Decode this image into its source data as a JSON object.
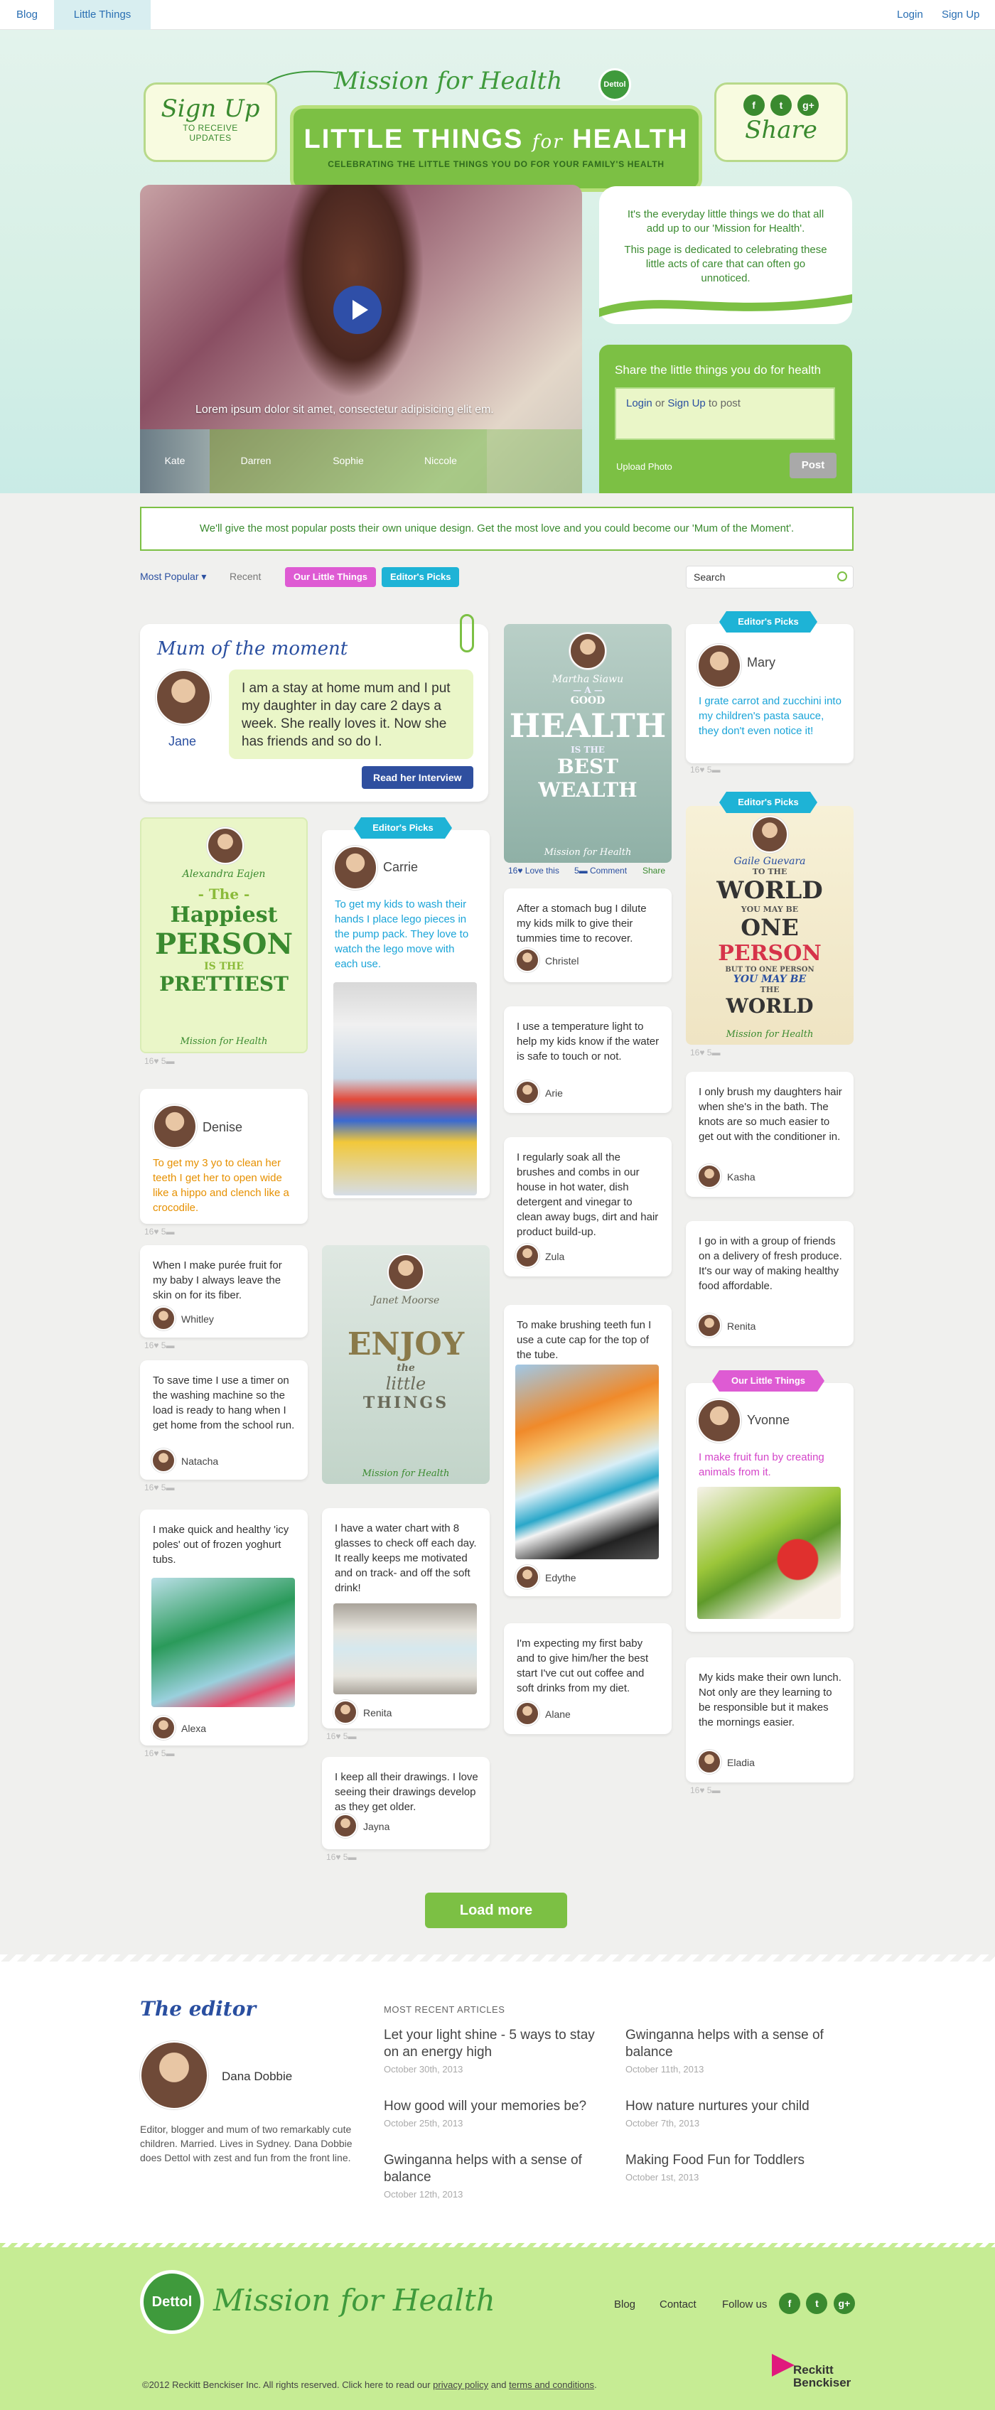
{
  "nav": {
    "blog": "Blog",
    "little_things": "Little Things",
    "login": "Login",
    "signup": "Sign Up"
  },
  "brand": {
    "mission": "Mission for Health",
    "dettol": "Dettol"
  },
  "signup_badge": {
    "title": "Sign Up",
    "line1": "TO RECEIVE",
    "line2": "UPDATES"
  },
  "banner": {
    "title_a": "LITTLE THINGS",
    "title_for": "for",
    "title_b": "HEALTH",
    "subtitle": "CELEBRATING THE LITTLE THINGS YOU DO FOR YOUR FAMILY'S HEALTH"
  },
  "share_badge": {
    "title": "Share",
    "icons": [
      "f",
      "t",
      "g+"
    ]
  },
  "video": {
    "caption": "Lorem ipsum dolor sit amet, consectetur adipisicing elit em.",
    "thumbs": [
      "Kate",
      "Darren",
      "Sophie",
      "Niccole"
    ]
  },
  "intro": {
    "p1": "It's the everyday little things we do that all add up to our 'Mission for Health'.",
    "p2": "This page is dedicated to celebrating these little acts of care that can often go unnoticed."
  },
  "share_form": {
    "label": "Share the little things you do for health",
    "login": "Login",
    "or": " or ",
    "signup": "Sign Up",
    "to_post": " to post",
    "upload": "Upload Photo",
    "post": "Post"
  },
  "notice": "We'll give the most popular posts their own unique design.  Get the most love and you could become our 'Mum of the Moment'.",
  "filters": {
    "most_popular": "Most Popular ▾",
    "recent": "Recent",
    "our_little_things": "Our Little Things",
    "editors_picks": "Editor's Picks",
    "search_placeholder": "Search"
  },
  "colors": {
    "green": "#7cc044",
    "dark_green": "#3a8a2f",
    "blue_ribbon": "#1eb3d6",
    "magenta_ribbon": "#de5bd3",
    "navy": "#2f4f9f"
  },
  "mum": {
    "title": "Mum of the moment",
    "quote": "I am a stay at home mum and I put my daughter in day care 2 days a week. She really loves it. Now she has friends and so do I.",
    "name": "Jane",
    "button": "Read her Interview"
  },
  "stats": {
    "default": "16♥ 5▬"
  },
  "col1": {
    "poster": {
      "name": "Alexandra Eajen",
      "l1": "- The -",
      "l2": "Happiest",
      "l3": "PERSON",
      "l4": "IS THE",
      "l5": "PRETTIEST",
      "foot": "Mission for Health"
    },
    "denise": {
      "name": "Denise",
      "text": "To get my 3 yo to clean her teeth I get her to open wide like a hippo and clench like a crocodile."
    },
    "whitley": {
      "text": "When I make purée fruit for my baby I always leave the skin on for its fiber.",
      "name": "Whitley"
    },
    "natacha": {
      "text": "To save time I use a timer on the washing machine so the load is ready to hang when I get home from the school run.",
      "name": "Natacha"
    },
    "alexa": {
      "text": "I make quick and healthy 'icy poles' out of frozen yoghurt tubs.",
      "name": "Alexa"
    }
  },
  "col2": {
    "carrie": {
      "ribbon": "Editor's Picks",
      "name": "Carrie",
      "text": "To get my kids to wash their hands I place lego pieces in the pump pack. They love to watch the lego move with each use."
    },
    "poster": {
      "name": "Janet Moorse",
      "l1": "ENJOY",
      "l2": "the",
      "l3": "little",
      "l4": "THINGS",
      "foot": "Mission for Health"
    },
    "renita": {
      "text": "I have a water chart with 8 glasses to check off each day. It really keeps me motivated and on track- and off the soft drink!",
      "name": "Renita"
    },
    "jayna": {
      "text": "I keep all their drawings. I love seeing their drawings develop as they get older.",
      "name": "Jayna"
    }
  },
  "col3": {
    "poster": {
      "name": "Martha Siawu",
      "l1": "— A —",
      "l2": "GOOD",
      "l3": "HEALTH",
      "l4": "IS THE",
      "l5": "BEST",
      "l6": "WEALTH",
      "foot": "Mission for Health",
      "love": "16♥ Love this",
      "comment": "5▬ Comment",
      "share": "Share"
    },
    "christel": {
      "text": "After a stomach bug I dilute my kids milk to give their tummies time to recover.",
      "name": "Christel"
    },
    "arie": {
      "text": "I use a temperature light to help my kids know if the water is safe to touch or not.",
      "name": "Arie"
    },
    "zula": {
      "text": "I regularly soak all the brushes and combs in our house in hot water, dish detergent and vinegar to clean away bugs, dirt and hair product build-up.",
      "name": "Zula"
    },
    "edythe": {
      "text": "To make brushing teeth fun I use a cute cap for the top of the tube.",
      "name": "Edythe"
    },
    "alane": {
      "text": "I'm expecting my first baby and to give him/her the best start I've cut out coffee and soft drinks from my diet.",
      "name": "Alane"
    }
  },
  "col4": {
    "mary": {
      "ribbon": "Editor's Picks",
      "name": "Mary",
      "text": "I grate carrot and zucchini into my children's pasta sauce, they don't even notice it!"
    },
    "poster": {
      "ribbon": "Editor's Picks",
      "name": "Gaile Guevara",
      "l1": "TO THE",
      "l2": "WORLD",
      "l3": "YOU MAY BE",
      "l4": "ONE",
      "l5": "PERSON",
      "l6": "BUT TO ONE PERSON",
      "l7": "YOU MAY BE",
      "l8": "THE",
      "l9": "WORLD",
      "foot": "Mission for Health"
    },
    "kasha": {
      "text": "I only brush my daughters hair when she's in the bath. The knots are so much easier to get out with the conditioner in.",
      "name": "Kasha"
    },
    "renita": {
      "text": "I go in with a group of friends on a delivery of fresh produce. It's our way of making healthy food affordable.",
      "name": "Renita"
    },
    "yvonne": {
      "ribbon": "Our Little Things",
      "name": "Yvonne",
      "text": "I make fruit fun by creating animals from it."
    },
    "eladia": {
      "text": "My kids make their own lunch. Not only are they learning to be responsible but it makes the mornings easier.",
      "name": "Eladia"
    }
  },
  "load_more": "Load more",
  "editor": {
    "heading": "The editor",
    "name": "Dana Dobbie",
    "bio": "Editor, blogger and mum of two remarkably cute children. Married. Lives in Sydney. Dana Dobbie does Dettol with zest and fun from the front line.",
    "recent_label": "MOST RECENT ARTICLES",
    "articles": [
      {
        "title": "Let your light shine - 5 ways to stay on an energy high",
        "date": "October 30th, 2013"
      },
      {
        "title": "Gwinganna helps with a sense of balance",
        "date": "October 11th, 2013"
      },
      {
        "title": "How good will your memories be?",
        "date": "October 25th, 2013"
      },
      {
        "title": "How nature nurtures your child",
        "date": "October 7th, 2013"
      },
      {
        "title": "Gwinganna helps with a sense of balance",
        "date": "October 12th, 2013"
      },
      {
        "title": "Making Food Fun for Toddlers",
        "date": "October 1st, 2013"
      }
    ]
  },
  "footer": {
    "dettol": "Dettol",
    "mission": "Mission for Health",
    "blog": "Blog",
    "contact": "Contact",
    "follow": "Follow us",
    "copyright_pre": "©2012 Reckitt Benckiser Inc. All rights reserved. Click here to read our ",
    "privacy": "privacy policy",
    "and": " and ",
    "terms": "terms and conditions",
    "dot": ".",
    "rb1": "Reckitt",
    "rb2": "Benckiser"
  }
}
